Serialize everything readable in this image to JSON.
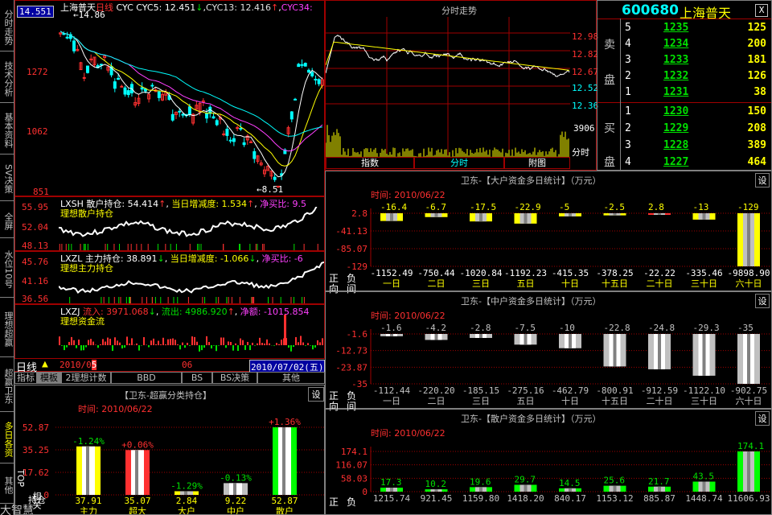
{
  "sidebar": {
    "tabs": [
      "分时走势",
      "技术分析",
      "基本资料",
      "SV决策",
      "全屏",
      "水位10号",
      "理想超赢",
      "超赢卫东",
      "多日各资",
      "相关",
      "TOP",
      "其他"
    ],
    "bottom_chars": "大智慧"
  },
  "kline": {
    "price_box": "14.551",
    "title": "上海普天",
    "period": "日线",
    "cyc_label": "CYC",
    "cyc5": "CYC5: 12.451",
    "cyc13": "CYC13: 12.416",
    "cyc34": "CYC34:",
    "cyc_arrow_down": "↓",
    "cyc_arrow_up": "↑",
    "high_label": "14.86",
    "low_label": "8.51",
    "y_labels": [
      "1272",
      "1062",
      "851"
    ]
  },
  "xssh": {
    "title": "LXSH 散户持仓: 54.414",
    "arrow": "↑",
    "rate": "当日增减度: 1.534",
    "rate_arrow": "↑",
    "ratio": "净买比: 9.5",
    "sub": "理想散户持仓",
    "y": [
      "55.95",
      "52.04",
      "48.13"
    ]
  },
  "xszl": {
    "title": "LXZL 主力持仓: 38.891",
    "arrow": "↓",
    "rate": "当日增减度: -1.066",
    "rate_arrow": "↓",
    "ratio": "净买比: -6",
    "sub": "理想主力持仓",
    "y": [
      "45.76",
      "41.16",
      "36.56"
    ]
  },
  "xzj": {
    "title": "LXZJ",
    "inflow": "流入: 3971.068",
    "inflow_arrow": "↓",
    "outflow": "流出: 4986.920",
    "outflow_arrow": "↑",
    "net": "净额: -1015.854",
    "sub": "理想资金流"
  },
  "dateline": {
    "period": "日线",
    "date_start": "2010/0",
    "date_start_b": "5",
    "mid": "06",
    "date_end": "2010/07/02(五)"
  },
  "tabs_row1": [
    "指标",
    "模板",
    "2理想计数",
    "BBD",
    "BS",
    "BS决策",
    "其他"
  ],
  "class_panel": {
    "title": "【卫东-超赢分类持仓】",
    "set": "设",
    "time": "时间: 2010/06/22",
    "y": [
      "52.87",
      "35.25",
      "17.62",
      "0"
    ],
    "bars": [
      {
        "pct": "-1.24%",
        "val": "37.91",
        "name": "主力",
        "h": 0.717
      },
      {
        "pct": "+0.06%",
        "val": "35.07",
        "name": "超大",
        "h": 0.663
      },
      {
        "pct": "-1.29%",
        "val": "2.84",
        "name": "大户",
        "h": 0.054
      },
      {
        "pct": "-0.13%",
        "val": "9.22",
        "name": "中户",
        "h": 0.174
      },
      {
        "pct": "+1.36%",
        "val": "52.87",
        "name": "散户",
        "h": 1.0
      }
    ],
    "side_label": "持仓"
  },
  "tick": {
    "title": "分时走势",
    "y_labels": [
      "12.98",
      "12.82",
      "12.67",
      "12.52",
      "12.36"
    ],
    "vol_label": "3906",
    "time_label": "分时",
    "tabs": [
      "指数",
      "分时",
      "附图"
    ]
  },
  "quote": {
    "code": "600680",
    "name": "上海普天",
    "close": "X",
    "sell_label": [
      "卖",
      "盘"
    ],
    "buy_label": [
      "买",
      "盘"
    ],
    "sells": [
      {
        "n": "5",
        "p": "1235",
        "v": "125"
      },
      {
        "n": "4",
        "p": "1234",
        "v": "200"
      },
      {
        "n": "3",
        "p": "1233",
        "v": "181"
      },
      {
        "n": "2",
        "p": "1232",
        "v": "126"
      },
      {
        "n": "1",
        "p": "1231",
        "v": "38"
      }
    ],
    "buys": [
      {
        "n": "1",
        "p": "1230",
        "v": "150"
      },
      {
        "n": "2",
        "p": "1229",
        "v": "208"
      },
      {
        "n": "3",
        "p": "1228",
        "v": "389"
      },
      {
        "n": "4",
        "p": "1227",
        "v": "464"
      }
    ]
  },
  "fund_panels": [
    {
      "title": "卫东-【大户资金多日统计】（万元）",
      "set": "设",
      "time": "时间: 2010/06/22",
      "y": [
        "2.8",
        "-41.13",
        "-85.07",
        "-129"
      ],
      "left": [
        "正",
        "负",
        "向",
        "间"
      ],
      "tops": [
        "-16.4",
        "-6.7",
        "-17.5",
        "-22.9",
        "-5",
        "-2.5",
        "2.8",
        "-13",
        "-129"
      ],
      "bottoms": [
        "-1152.49",
        "-750.44",
        "-1020.84",
        "-1192.23",
        "-415.35",
        "-378.25",
        "-22.22",
        "-335.46",
        "-9898.90"
      ],
      "days": [
        "一日",
        "二日",
        "三日",
        "五日",
        "十日",
        "十五日",
        "二十日",
        "三十日",
        "六十日"
      ],
      "vals": [
        -16.4,
        -6.7,
        -17.5,
        -22.9,
        -5,
        -2.5,
        2.8,
        -13,
        -129
      ],
      "range": [
        -129,
        2.8
      ]
    },
    {
      "title": "卫东-【中户资金多日统计】（万元）",
      "set": "设",
      "time": "时间: 2010/06/22",
      "y": [
        "-1.6",
        "-12.73",
        "-23.87",
        "-35"
      ],
      "left": [
        "正",
        "负",
        "向",
        "间"
      ],
      "tops": [
        "-1.6",
        "-4.2",
        "-2.8",
        "-7.5",
        "-10",
        "-22.8",
        "-24.8",
        "-29.3",
        "-35"
      ],
      "bottoms": [
        "-112.44",
        "-220.20",
        "-185.15",
        "-275.16",
        "-462.79",
        "-800.91",
        "-912.59",
        "-1122.10",
        "-902.75"
      ],
      "days": [
        "一日",
        "二日",
        "三日",
        "五日",
        "十日",
        "十五日",
        "二十日",
        "三十日",
        "六十日"
      ],
      "vals": [
        -1.6,
        -4.2,
        -2.8,
        -7.5,
        -10,
        -22.8,
        -24.8,
        -29.3,
        -35
      ],
      "range": [
        -35,
        0
      ]
    },
    {
      "title": "卫东-【散户资金多日统计】（万元）",
      "set": "设",
      "time": "时间: 2010/06/22",
      "y": [
        "174.1",
        "116.07",
        "58.03",
        "0"
      ],
      "left": [
        "正",
        "负"
      ],
      "tops": [
        "17.3",
        "10.2",
        "19.6",
        "29.7",
        "14.5",
        "25.6",
        "21.7",
        "43.5",
        "174.1"
      ],
      "bottoms": [
        "1215.74",
        "921.45",
        "1159.80",
        "1418.20",
        "840.17",
        "1153.12",
        "885.87",
        "1448.74",
        "11606.93"
      ],
      "days": [],
      "vals": [
        17.3,
        10.2,
        19.6,
        29.7,
        14.5,
        25.6,
        21.7,
        43.5,
        174.1
      ],
      "range": [
        0,
        174.1
      ]
    }
  ]
}
